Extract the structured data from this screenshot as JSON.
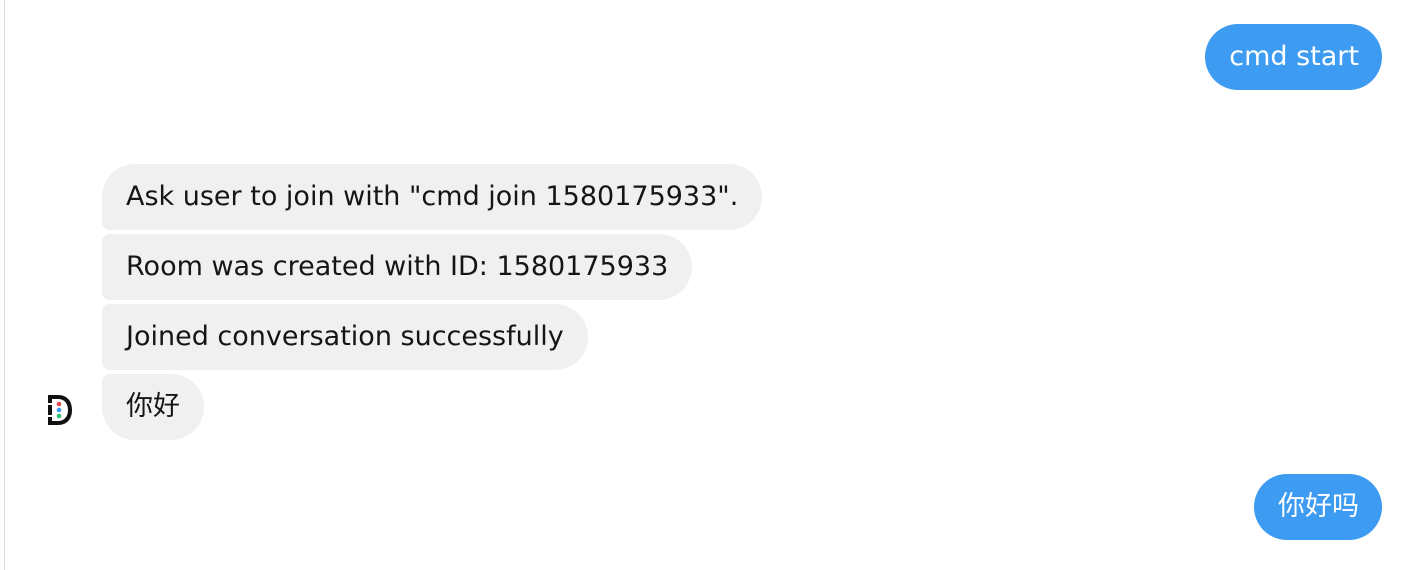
{
  "chat": {
    "messages": [
      {
        "sender": "user",
        "text": "cmd start"
      },
      {
        "sender": "bot",
        "text": "Ask user to join with \"cmd join 1580175933\"."
      },
      {
        "sender": "bot",
        "text": "Room was created with ID: 1580175933"
      },
      {
        "sender": "bot",
        "text": "Joined conversation successfully"
      },
      {
        "sender": "bot",
        "text": "你好"
      },
      {
        "sender": "user",
        "text": "你好吗"
      }
    ],
    "bot_avatar_icon": "bot-logo-icon",
    "colors": {
      "outgoing_bubble": "#3d9bf2",
      "incoming_bubble": "#f0f0f0",
      "outgoing_text": "#ffffff",
      "incoming_text": "#151515"
    }
  }
}
